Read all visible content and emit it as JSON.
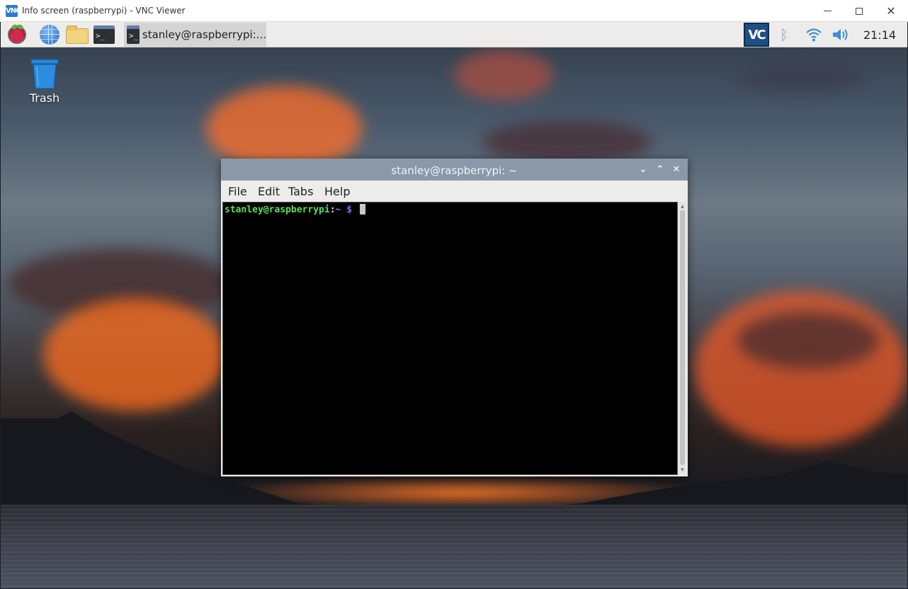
{
  "vnc_window": {
    "app_icon": "VNC",
    "title": "Info screen (raspberrypi) - VNC Viewer",
    "controls": {
      "minimize": "minimize-icon",
      "maximize": "maximize-icon",
      "close": "✕"
    }
  },
  "panel": {
    "launchers": [
      {
        "name": "raspberry-pi-menu",
        "icon": "raspberry-icon"
      },
      {
        "name": "web-browser",
        "icon": "globe-icon"
      },
      {
        "name": "file-manager",
        "icon": "folder-icon"
      },
      {
        "name": "terminal",
        "icon": "terminal-icon",
        "glyph": ">_"
      }
    ],
    "task_button": {
      "label": "stanley@raspberrypi:...",
      "icon": "terminal-icon",
      "glyph": ">_"
    },
    "tray": {
      "vnc_icon": "VC",
      "bluetooth_icon": "ᛒ",
      "wifi_icon": "wifi-icon",
      "volume_icon": "volume-icon",
      "clock": "21:14"
    }
  },
  "desktop": {
    "icons": [
      {
        "label": "Trash",
        "icon": "trash-icon"
      }
    ]
  },
  "terminal_window": {
    "title": "stanley@raspberrypi: ~",
    "controls": {
      "minimize": "⌄",
      "maximize": "⌃",
      "close": "✕"
    },
    "menu": {
      "file": "File",
      "edit": "Edit",
      "tabs": "Tabs",
      "help": "Help"
    },
    "prompt": {
      "user_host": "stanley@raspberrypi",
      "colon": ":",
      "path": "~",
      "symbol": " $ "
    },
    "scroll_up": "▲",
    "scroll_down": "▼"
  },
  "colors": {
    "terminal_titlebar": "#8a98a8",
    "prompt_user": "#55e05a",
    "prompt_path": "#6b7bff",
    "vnc_accent": "#1f4e85"
  }
}
